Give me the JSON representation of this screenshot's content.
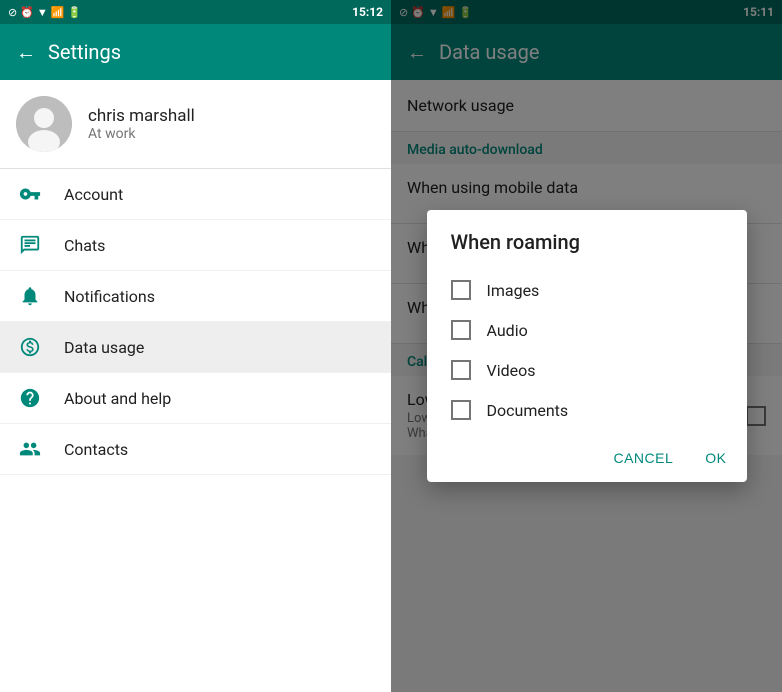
{
  "left": {
    "status_bar": {
      "time": "15:12",
      "icons": [
        "no-disturb",
        "alarm",
        "wifi",
        "signal",
        "battery"
      ]
    },
    "title": "Settings",
    "profile": {
      "name": "chris marshall",
      "status": "At work"
    },
    "menu_items": [
      {
        "id": "account",
        "label": "Account",
        "icon": "key-icon"
      },
      {
        "id": "chats",
        "label": "Chats",
        "icon": "chat-icon"
      },
      {
        "id": "notifications",
        "label": "Notifications",
        "icon": "bell-icon"
      },
      {
        "id": "data-usage",
        "label": "Data usage",
        "icon": "data-icon",
        "active": true
      },
      {
        "id": "about-help",
        "label": "About and help",
        "icon": "help-icon"
      },
      {
        "id": "contacts",
        "label": "Contacts",
        "icon": "contacts-icon"
      }
    ]
  },
  "right": {
    "status_bar": {
      "time": "15:11",
      "icons": [
        "no-disturb",
        "alarm",
        "wifi",
        "signal",
        "battery"
      ]
    },
    "title": "Data usage",
    "network_usage_label": "Network usage",
    "media_auto_download_label": "Media auto-download",
    "call_settings_label": "Call settings",
    "low_data": {
      "title": "Low data usage",
      "description": "Lower the amount of data used during a WhatsApp call"
    }
  },
  "dialog": {
    "title": "When roaming",
    "options": [
      {
        "id": "images",
        "label": "Images",
        "checked": false
      },
      {
        "id": "audio",
        "label": "Audio",
        "checked": false
      },
      {
        "id": "videos",
        "label": "Videos",
        "checked": false
      },
      {
        "id": "documents",
        "label": "Documents",
        "checked": false
      }
    ],
    "cancel_label": "CANCEL",
    "ok_label": "OK"
  }
}
